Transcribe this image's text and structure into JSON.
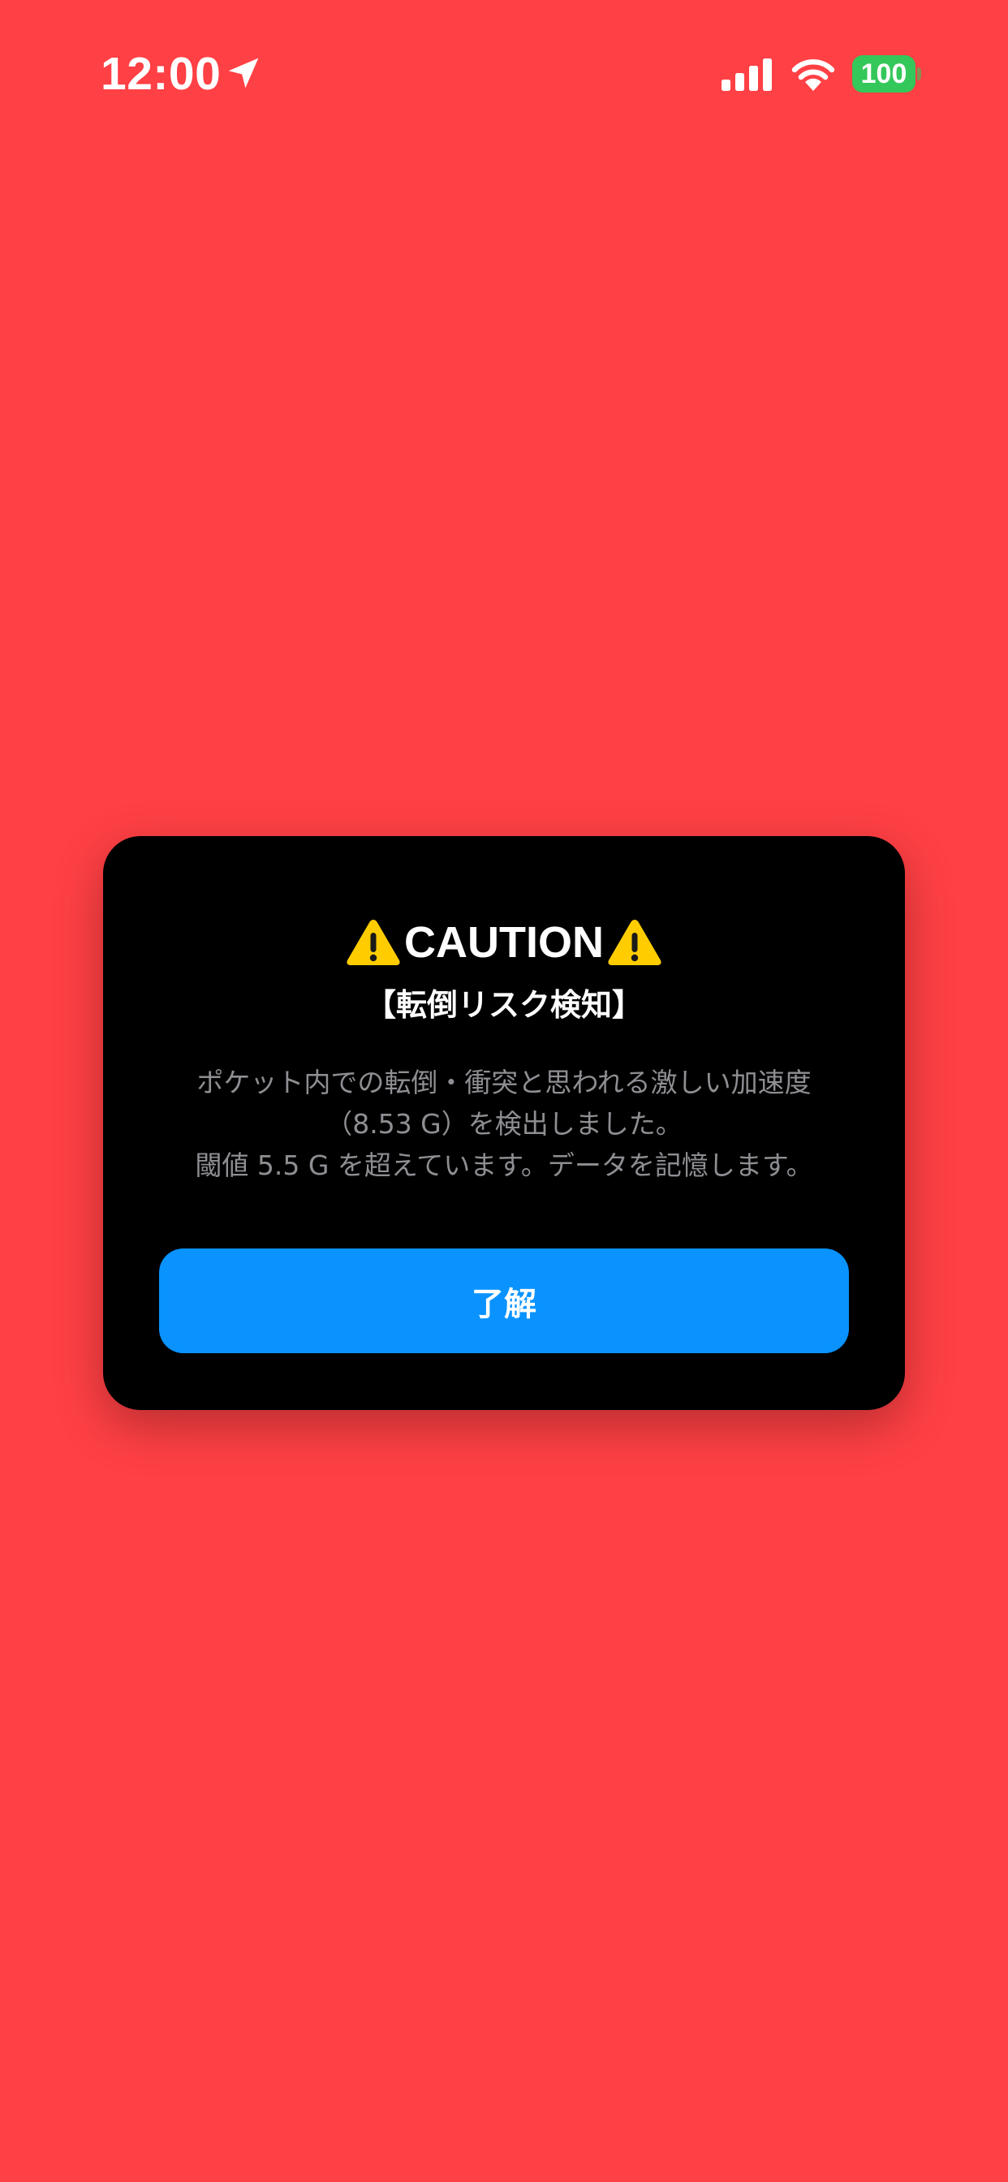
{
  "status_bar": {
    "time": "12:00",
    "battery_level": "100",
    "icons": [
      "location-arrow-icon",
      "cellular-signal-icon",
      "wifi-icon",
      "battery-icon"
    ]
  },
  "alert": {
    "title": "CAUTION",
    "title_icon": "warning-icon",
    "subtitle": "【転倒リスク検知】",
    "message_lines": [
      "ポケット内での転倒・衝突と思われる激しい加速度",
      "（8.53 G）を検出しました。",
      "閾値 5.5 G を超えています。データを記憶します。"
    ],
    "button_label": "了解"
  },
  "colors": {
    "background": "#FF4044",
    "card": "#000000",
    "button": "#0A93FF",
    "battery": "#34C759",
    "message_text": "#8E8E93",
    "warning_yellow": "#FFCC00"
  }
}
